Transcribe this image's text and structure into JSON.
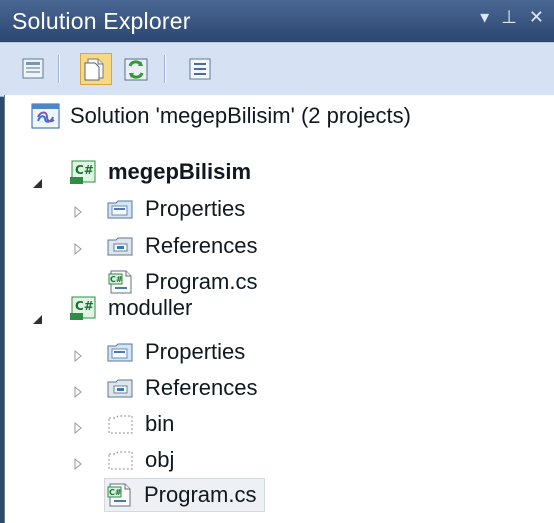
{
  "window": {
    "title": "Solution Explorer"
  },
  "toolbar": {
    "buttons": [
      {
        "icon": "properties-icon"
      },
      {
        "icon": "show-all-files-icon",
        "active": true
      },
      {
        "icon": "refresh-icon"
      },
      {
        "icon": "view-class-diagram-icon"
      }
    ]
  },
  "tree": {
    "solution": "Solution 'megepBilisim' (2 projects)",
    "project1": {
      "name": "megepBilisim",
      "properties": "Properties",
      "references": "References",
      "program": "Program.cs"
    },
    "project2": {
      "name": "moduller",
      "properties": "Properties",
      "references": "References",
      "bin": "bin",
      "obj": "obj",
      "program": "Program.cs"
    }
  }
}
